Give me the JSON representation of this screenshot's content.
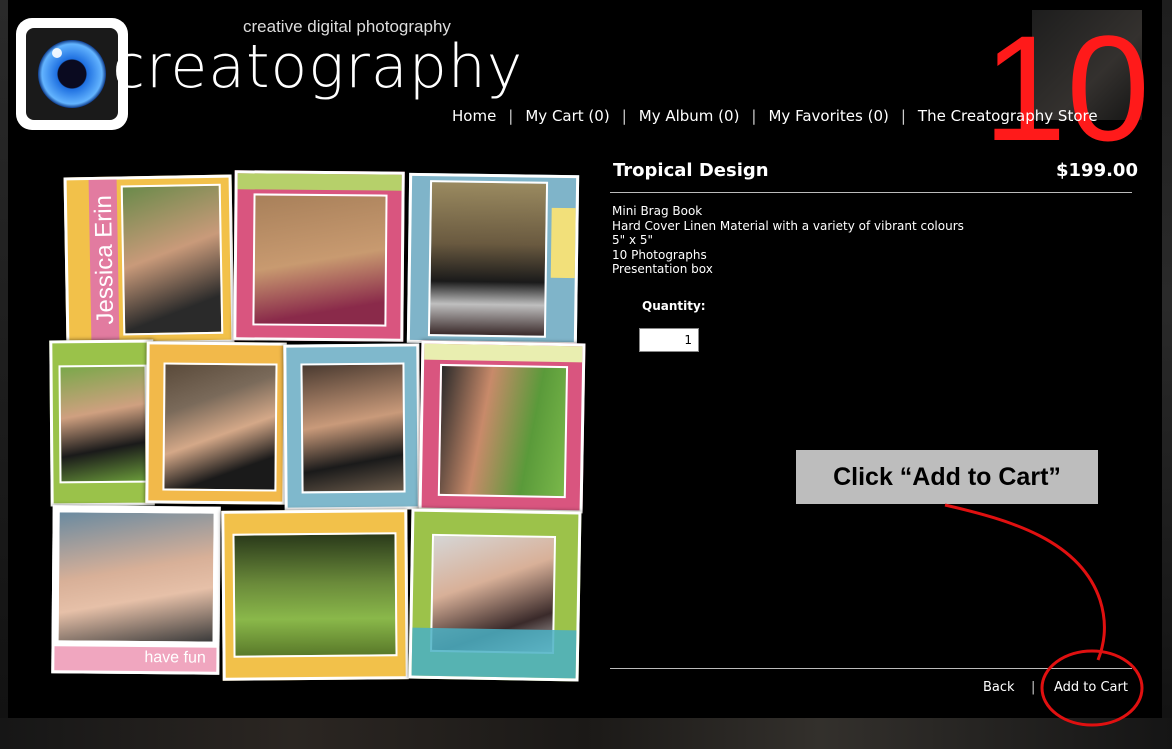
{
  "brand": {
    "tagline": "creative digital photography",
    "name": "creatography"
  },
  "step_number": "10",
  "nav": {
    "items": [
      {
        "label": "Home"
      },
      {
        "label": "My Cart (0)"
      },
      {
        "label": "My Album (0)"
      },
      {
        "label": "My Favorites (0)"
      },
      {
        "label": "The Creatography Store"
      }
    ],
    "separator": "|"
  },
  "collage": {
    "name_text": "Jessica Erin",
    "fun_text": "have fun"
  },
  "product": {
    "title": "Tropical Design",
    "price": "$199.00",
    "details": [
      "Mini Brag Book",
      "Hard Cover Linen Material with a variety of vibrant colours",
      "5\" x 5\"",
      "10 Photographs",
      "Presentation box"
    ],
    "quantity_label": "Quantity:",
    "quantity_value": "1"
  },
  "actions": {
    "back_label": "Back",
    "separator": "|",
    "add_to_cart_label": "Add to Cart"
  },
  "annotation": {
    "callout_text": "Click “Add to Cart”",
    "accent_color": "#e01010"
  }
}
